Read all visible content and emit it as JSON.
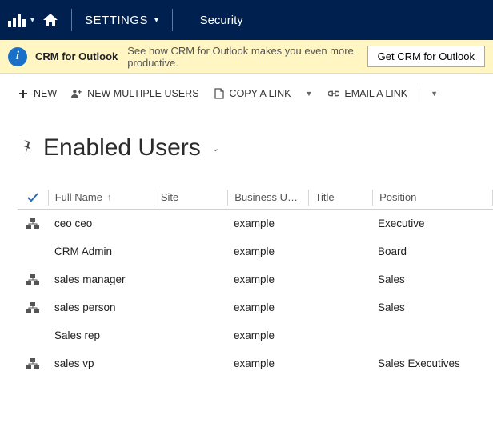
{
  "navbar": {
    "settings_label": "SETTINGS",
    "security_label": "Security"
  },
  "notification": {
    "title": "CRM for Outlook",
    "text": "See how CRM for Outlook makes you even more productive.",
    "button": "Get CRM for Outlook"
  },
  "toolbar": {
    "new_": "NEW",
    "new_multiple": "NEW MULTIPLE USERS",
    "copy_link": "COPY A LINK",
    "email_link": "EMAIL A LINK"
  },
  "page": {
    "title": "Enabled Users"
  },
  "grid": {
    "headers": {
      "full_name": "Full Name",
      "site": "Site",
      "business_unit": "Business Unit...",
      "title": "Title",
      "position": "Position"
    },
    "rows": [
      {
        "hier": true,
        "name": "ceo ceo",
        "site": "",
        "bu": "example",
        "title": "",
        "pos": "Executive"
      },
      {
        "hier": false,
        "name": "CRM Admin",
        "site": "",
        "bu": "example",
        "title": "",
        "pos": "Board"
      },
      {
        "hier": true,
        "name": "sales manager",
        "site": "",
        "bu": "example",
        "title": "",
        "pos": "Sales"
      },
      {
        "hier": true,
        "name": "sales person",
        "site": "",
        "bu": "example",
        "title": "",
        "pos": "Sales"
      },
      {
        "hier": false,
        "name": "Sales rep",
        "site": "",
        "bu": "example",
        "title": "",
        "pos": ""
      },
      {
        "hier": true,
        "name": "sales vp",
        "site": "",
        "bu": "example",
        "title": "",
        "pos": "Sales Executives"
      }
    ]
  }
}
